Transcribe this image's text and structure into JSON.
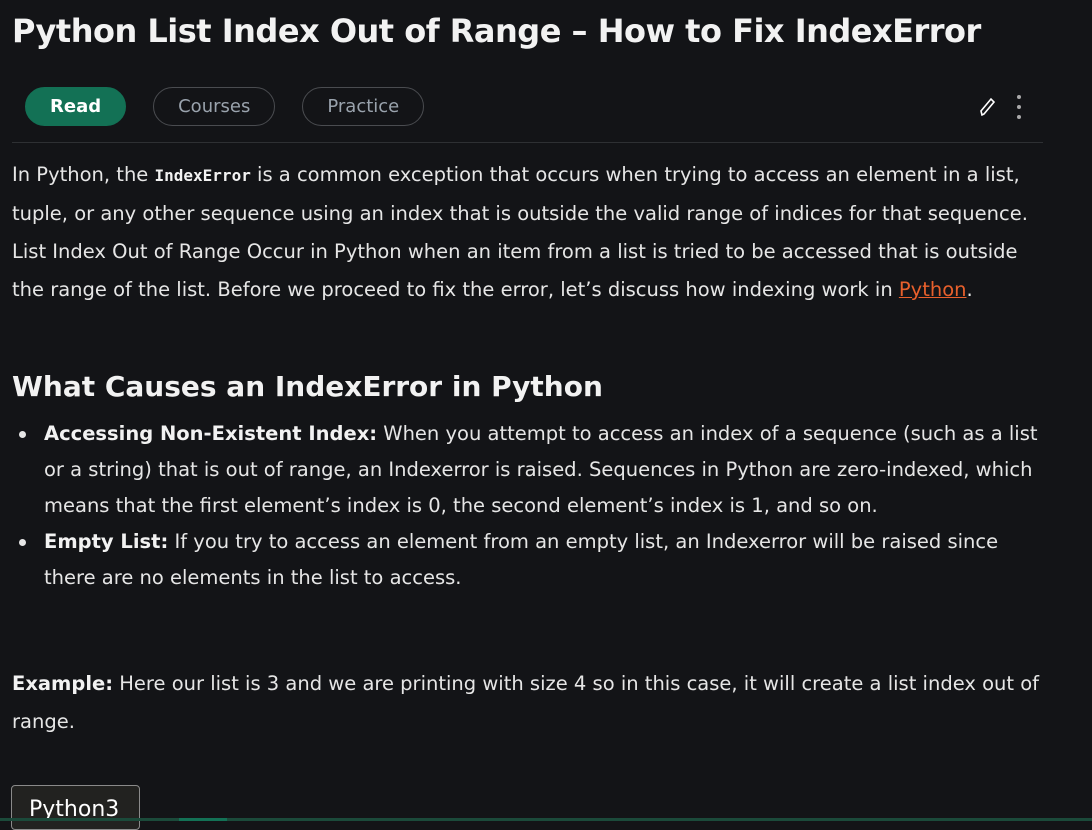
{
  "title": "Python List Index Out of Range – How to Fix IndexError",
  "tabs": [
    {
      "label": "Read",
      "active": true
    },
    {
      "label": "Courses"
    },
    {
      "label": "Practice"
    }
  ],
  "icons": [
    "pencil-icon",
    "more-vertical-icon"
  ],
  "intro": {
    "t1": "In Python, the ",
    "code": "IndexError",
    "t2": " is a common exception that occurs when trying to access an element in a list, tuple, or any other sequence using an index that is outside the valid range of indices for that sequence. List Index Out of Range Occur in Python when an item from a list is tried to be accessed that is outside the range of the list. Before we proceed to fix the error, let’s discuss how indexing work in ",
    "link": "Python",
    "t3": "."
  },
  "section": {
    "heading": "What Causes an IndexError in Python",
    "items": [
      {
        "term": "Accessing Non-Existent Index:",
        "text": " When you attempt to access an index of a sequence (such as a list or a string) that is out of range, an Indexerror is raised. Sequences in Python are zero-indexed, which means that the first element’s index is 0, the second element’s index is 1, and so on."
      },
      {
        "term": "Empty List:",
        "text": " If you try to access an element from an empty list, an Indexerror will be raised since there are no elements in the list to access."
      }
    ]
  },
  "example": {
    "term": "Example:",
    "text": " Here our list is 3 and we are printing with size 4 so in this case, it will create a list index out of range."
  },
  "code_tab": "Python3",
  "colors": {
    "accent": "#137155",
    "link": "#e8602c",
    "background": "#131417"
  }
}
